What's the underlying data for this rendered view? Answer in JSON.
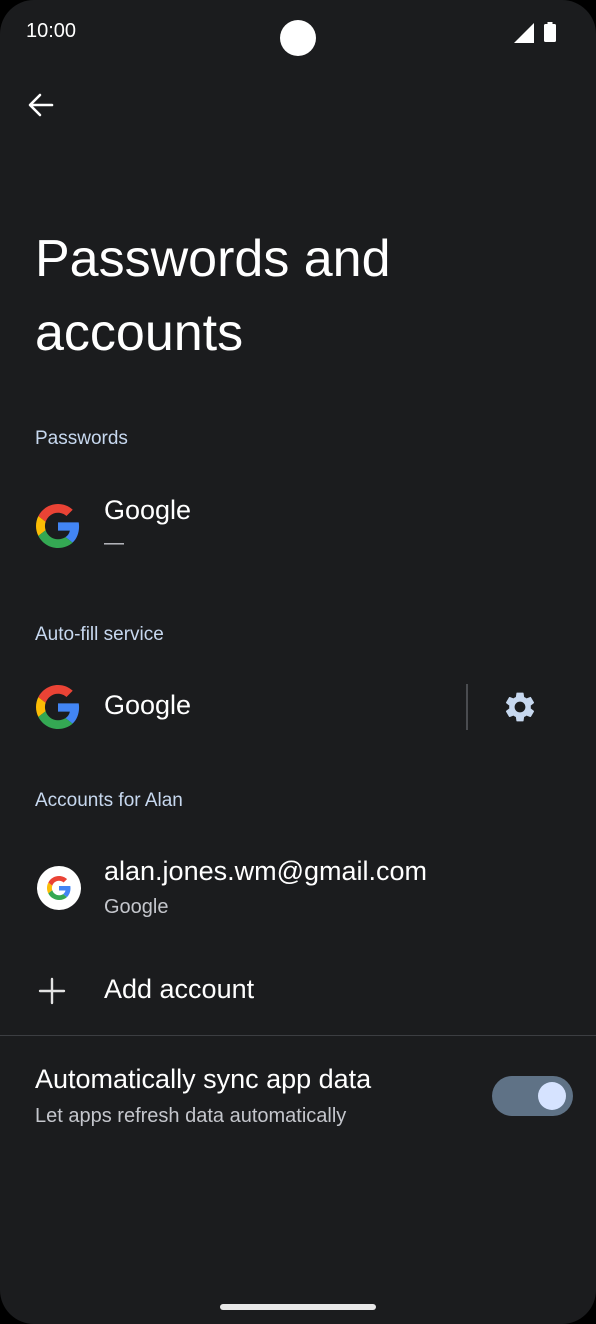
{
  "status_bar": {
    "time": "10:00",
    "icons": [
      "camera-cutout",
      "signal-icon",
      "battery-icon"
    ]
  },
  "header": {
    "back_icon": "arrow-back-icon",
    "title": "Passwords and accounts"
  },
  "passwords": {
    "section_label": "Passwords",
    "provider": {
      "icon": "google-g-icon",
      "name": "Google",
      "summary": "—"
    }
  },
  "autofill": {
    "section_label": "Auto-fill service",
    "provider": {
      "icon": "google-g-icon",
      "name": "Google"
    },
    "settings_icon": "gear-icon"
  },
  "accounts": {
    "section_label": "Accounts for Alan",
    "items": [
      {
        "icon": "google-g-icon",
        "email": "alan.jones.wm@gmail.com",
        "type": "Google"
      }
    ],
    "add_label": "Add account",
    "add_icon": "plus-icon"
  },
  "sync": {
    "title": "Automatically sync app data",
    "subtitle": "Let apps refresh data automatically",
    "enabled": true
  },
  "colors": {
    "background": "#1b1c1e",
    "section_label": "#c7d8ef",
    "toggle_track": "#5f7286",
    "toggle_thumb": "#d6e3ff"
  }
}
